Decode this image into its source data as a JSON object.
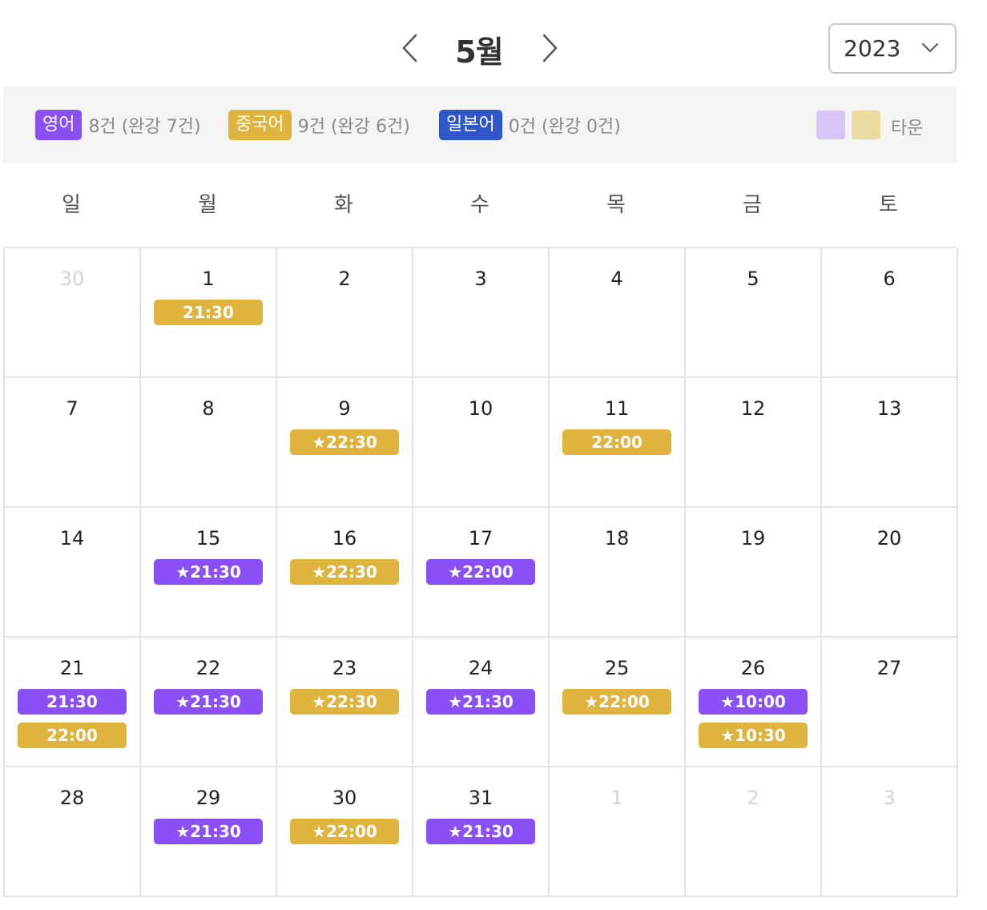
{
  "header": {
    "month": "5월",
    "year": "2023"
  },
  "colors": {
    "english": "#8a4ff5",
    "chinese": "#dfb43c",
    "japanese": "#2f55c8",
    "town_purple": "#d6c6f5",
    "town_yellow": "#ebdca4"
  },
  "legend": {
    "english": {
      "label": "영어",
      "count": "8건 (완강 7건)"
    },
    "chinese": {
      "label": "중국어",
      "count": "9건 (완강 6건)"
    },
    "japanese": {
      "label": "일본어",
      "count": "0건 (완강 0건)"
    },
    "town": "타운"
  },
  "weekdays": [
    "일",
    "월",
    "화",
    "수",
    "목",
    "금",
    "토"
  ],
  "weeks": [
    [
      {
        "day": "30",
        "muted": true,
        "events": []
      },
      {
        "day": "1",
        "events": [
          {
            "time": "21:30",
            "lang": "chinese"
          }
        ]
      },
      {
        "day": "2",
        "events": []
      },
      {
        "day": "3",
        "events": []
      },
      {
        "day": "4",
        "events": []
      },
      {
        "day": "5",
        "events": []
      },
      {
        "day": "6",
        "events": []
      }
    ],
    [
      {
        "day": "7",
        "events": []
      },
      {
        "day": "8",
        "events": []
      },
      {
        "day": "9",
        "events": [
          {
            "time": "★22:30",
            "lang": "chinese"
          }
        ]
      },
      {
        "day": "10",
        "events": []
      },
      {
        "day": "11",
        "events": [
          {
            "time": "22:00",
            "lang": "chinese"
          }
        ]
      },
      {
        "day": "12",
        "events": []
      },
      {
        "day": "13",
        "events": []
      }
    ],
    [
      {
        "day": "14",
        "events": []
      },
      {
        "day": "15",
        "events": [
          {
            "time": "★21:30",
            "lang": "english"
          }
        ]
      },
      {
        "day": "16",
        "events": [
          {
            "time": "★22:30",
            "lang": "chinese"
          }
        ]
      },
      {
        "day": "17",
        "events": [
          {
            "time": "★22:00",
            "lang": "english"
          }
        ]
      },
      {
        "day": "18",
        "events": []
      },
      {
        "day": "19",
        "events": []
      },
      {
        "day": "20",
        "events": []
      }
    ],
    [
      {
        "day": "21",
        "events": [
          {
            "time": "21:30",
            "lang": "english"
          },
          {
            "time": "22:00",
            "lang": "chinese"
          }
        ]
      },
      {
        "day": "22",
        "events": [
          {
            "time": "★21:30",
            "lang": "english"
          }
        ]
      },
      {
        "day": "23",
        "events": [
          {
            "time": "★22:30",
            "lang": "chinese"
          }
        ]
      },
      {
        "day": "24",
        "events": [
          {
            "time": "★21:30",
            "lang": "english"
          }
        ]
      },
      {
        "day": "25",
        "events": [
          {
            "time": "★22:00",
            "lang": "chinese"
          }
        ]
      },
      {
        "day": "26",
        "events": [
          {
            "time": "★10:00",
            "lang": "english"
          },
          {
            "time": "★10:30",
            "lang": "chinese"
          }
        ]
      },
      {
        "day": "27",
        "events": []
      }
    ],
    [
      {
        "day": "28",
        "events": []
      },
      {
        "day": "29",
        "events": [
          {
            "time": "★21:30",
            "lang": "english"
          }
        ]
      },
      {
        "day": "30",
        "events": [
          {
            "time": "★22:00",
            "lang": "chinese"
          }
        ]
      },
      {
        "day": "31",
        "events": [
          {
            "time": "★21:30",
            "lang": "english"
          }
        ]
      },
      {
        "day": "1",
        "muted": true,
        "events": []
      },
      {
        "day": "2",
        "muted": true,
        "events": []
      },
      {
        "day": "3",
        "muted": true,
        "events": []
      }
    ]
  ]
}
